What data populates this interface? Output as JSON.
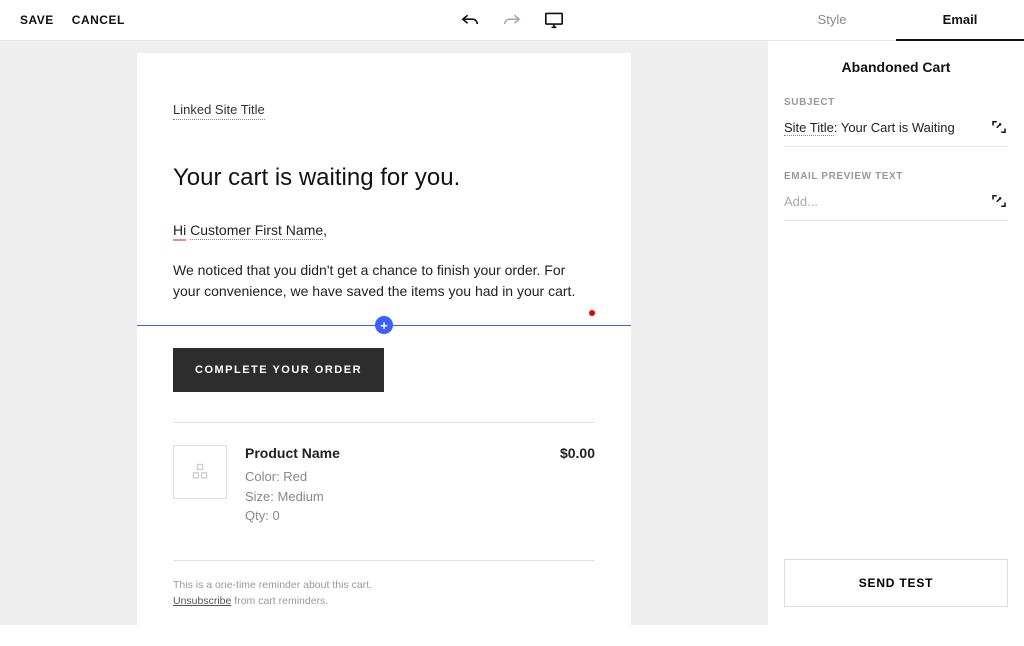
{
  "toolbar": {
    "save": "SAVE",
    "cancel": "CANCEL"
  },
  "tabs": {
    "style": "Style",
    "email": "Email"
  },
  "panel": {
    "title": "Abandoned Cart",
    "subject_label": "SUBJECT",
    "subject_site_title": "Site Title",
    "subject_rest": ": Your Cart is Waiting",
    "preview_label": "EMAIL PREVIEW TEXT",
    "preview_placeholder": "Add...",
    "send_test": "SEND TEST"
  },
  "email": {
    "site_title": "Linked Site Title",
    "headline": "Your cart is waiting for you.",
    "greeting_hi": "Hi",
    "greeting_name": "Customer First Name",
    "greeting_comma": ",",
    "paragraph": "We noticed that you didn't get a chance to finish your order. For your convenience, we have saved the items you had in your cart.",
    "cta": "COMPLETE YOUR ORDER",
    "product": {
      "name": "Product Name",
      "color_label": "Color: ",
      "color": "Red",
      "size_label": "Size: ",
      "size": "Medium",
      "qty_label": "Qty: ",
      "qty": "0",
      "price": "$0.00"
    },
    "footer_line1": "This is a one-time reminder about this cart.",
    "footer_unsub": "Unsubscribe",
    "footer_rest": " from cart reminders."
  },
  "insert_plus": "+"
}
